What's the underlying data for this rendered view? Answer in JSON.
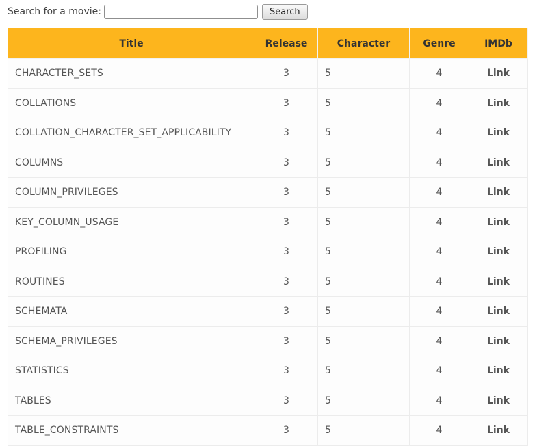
{
  "search": {
    "label": "Search for a movie:",
    "value": "",
    "placeholder": "",
    "button_label": "Search"
  },
  "table": {
    "headers": {
      "title": "Title",
      "release": "Release",
      "character": "Character",
      "genre": "Genre",
      "imdb": "IMDb"
    },
    "rows": [
      {
        "title": "CHARACTER_SETS",
        "release": "3",
        "character": "5",
        "genre": "4",
        "imdb": "Link"
      },
      {
        "title": "COLLATIONS",
        "release": "3",
        "character": "5",
        "genre": "4",
        "imdb": "Link"
      },
      {
        "title": "COLLATION_CHARACTER_SET_APPLICABILITY",
        "release": "3",
        "character": "5",
        "genre": "4",
        "imdb": "Link"
      },
      {
        "title": "COLUMNS",
        "release": "3",
        "character": "5",
        "genre": "4",
        "imdb": "Link"
      },
      {
        "title": "COLUMN_PRIVILEGES",
        "release": "3",
        "character": "5",
        "genre": "4",
        "imdb": "Link"
      },
      {
        "title": "KEY_COLUMN_USAGE",
        "release": "3",
        "character": "5",
        "genre": "4",
        "imdb": "Link"
      },
      {
        "title": "PROFILING",
        "release": "3",
        "character": "5",
        "genre": "4",
        "imdb": "Link"
      },
      {
        "title": "ROUTINES",
        "release": "3",
        "character": "5",
        "genre": "4",
        "imdb": "Link"
      },
      {
        "title": "SCHEMATA",
        "release": "3",
        "character": "5",
        "genre": "4",
        "imdb": "Link"
      },
      {
        "title": "SCHEMA_PRIVILEGES",
        "release": "3",
        "character": "5",
        "genre": "4",
        "imdb": "Link"
      },
      {
        "title": "STATISTICS",
        "release": "3",
        "character": "5",
        "genre": "4",
        "imdb": "Link"
      },
      {
        "title": "TABLES",
        "release": "3",
        "character": "5",
        "genre": "4",
        "imdb": "Link"
      },
      {
        "title": "TABLE_CONSTRAINTS",
        "release": "3",
        "character": "5",
        "genre": "4",
        "imdb": "Link"
      }
    ]
  },
  "colors": {
    "header_background": "#fdb51d",
    "border": "#ececec"
  }
}
